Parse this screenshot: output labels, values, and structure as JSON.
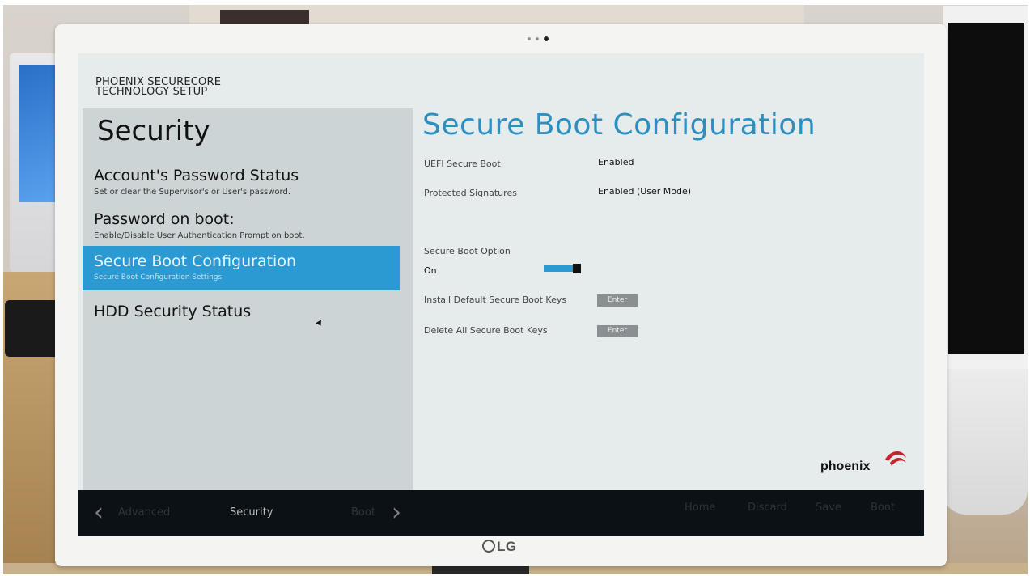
{
  "header": {
    "line1": "PHOENIX SECURECORE",
    "line2": "TECHNOLOGY SETUP"
  },
  "sidebar": {
    "section_title": "Security",
    "items": [
      {
        "label": "Account's Password Status",
        "description": "Set or clear the Supervisor's or User's password."
      },
      {
        "label": "Password on boot:",
        "description": "Enable/Disable User Authentication Prompt on boot."
      },
      {
        "label": "Secure Boot Configuration",
        "description": "Secure Boot Configuration Settings",
        "active": true
      },
      {
        "label": "HDD Security Status",
        "description": ""
      }
    ]
  },
  "main": {
    "title": "Secure Boot Configuration",
    "uefi_secure_boot": {
      "label": "UEFI Secure Boot",
      "value": "Enabled"
    },
    "protected_signatures": {
      "label": "Protected Signatures",
      "value": "Enabled (User Mode)"
    },
    "secure_boot_option": {
      "label": "Secure Boot Option",
      "value": "On",
      "toggle_on": true,
      "toggle_color": "#2b9ad2"
    },
    "install_keys": {
      "label": "Install Default Secure Boot Keys",
      "button": "Enter"
    },
    "delete_keys": {
      "label": "Delete All Secure Boot Keys",
      "button": "Enter"
    },
    "accent_color": "#2b8fc0"
  },
  "logo": {
    "text": "phoenix",
    "icon": "phoenix-swoosh-icon",
    "color": "#c0262d"
  },
  "footer": {
    "prev_tab": "Advanced",
    "current_tab": "Security",
    "next_tab": "Boot",
    "buttons": {
      "home": "Home",
      "discard": "Discard",
      "save": "Save",
      "boot": "Boot"
    }
  },
  "monitor": {
    "brand": "LG"
  }
}
